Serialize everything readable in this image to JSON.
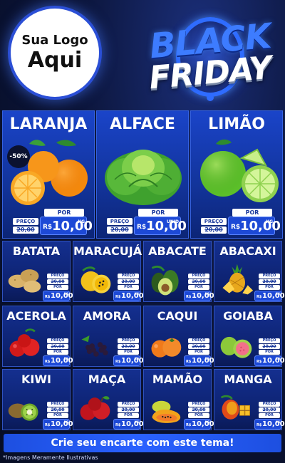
{
  "logo": {
    "line1": "Sua Logo",
    "line2": "Aqui"
  },
  "banner": {
    "black": "BLACK",
    "friday": "FRIDAY"
  },
  "featured": [
    {
      "name": "LARANJA",
      "discount": "-50%",
      "preco_label": "PREÇO",
      "old": "20,00",
      "por": "POR",
      "currency": "R$",
      "price": "10,00",
      "unit": "KG"
    },
    {
      "name": "ALFACE",
      "preco_label": "PREÇO",
      "old": "20,00",
      "por": "POR",
      "currency": "R$",
      "price": "10,00",
      "unit": "UNID"
    },
    {
      "name": "LIMÃO",
      "preco_label": "PREÇO",
      "old": "20,00",
      "por": "POR",
      "currency": "R$",
      "price": "10,00",
      "unit": "KG"
    }
  ],
  "products": [
    {
      "name": "BATATA",
      "preco_label": "PREÇO",
      "old": "20,00",
      "por": "POR",
      "currency": "R$",
      "price": "10,00",
      "unit": "KG"
    },
    {
      "name": "MARACUJÁ",
      "preco_label": "PREÇO",
      "old": "20,00",
      "por": "POR",
      "currency": "R$",
      "price": "10,00",
      "unit": "KG"
    },
    {
      "name": "ABACATE",
      "preco_label": "PREÇO",
      "old": "20,00",
      "por": "POR",
      "currency": "R$",
      "price": "10,00",
      "unit": "KG"
    },
    {
      "name": "ABACAXI",
      "preco_label": "PREÇO",
      "old": "20,00",
      "por": "POR",
      "currency": "R$",
      "price": "10,00",
      "unit": "KG"
    },
    {
      "name": "ACEROLA",
      "preco_label": "PREÇO",
      "old": "20,00",
      "por": "POR",
      "currency": "R$",
      "price": "10,00",
      "unit": "KG"
    },
    {
      "name": "AMORA",
      "preco_label": "PREÇO",
      "old": "20,00",
      "por": "POR",
      "currency": "R$",
      "price": "10,00",
      "unit": "KG"
    },
    {
      "name": "CAQUI",
      "preco_label": "PREÇO",
      "old": "20,00",
      "por": "POR",
      "currency": "R$",
      "price": "10,00",
      "unit": "KG"
    },
    {
      "name": "GOIABA",
      "preco_label": "PREÇO",
      "old": "20,00",
      "por": "POR",
      "currency": "R$",
      "price": "10,00",
      "unit": "KG"
    },
    {
      "name": "KIWI",
      "preco_label": "PREÇO",
      "old": "20,00",
      "por": "POR",
      "currency": "R$",
      "price": "10,00",
      "unit": "KG"
    },
    {
      "name": "MAÇA",
      "preco_label": "PREÇO",
      "old": "20,00",
      "por": "POR",
      "currency": "R$",
      "price": "10,00",
      "unit": "KG"
    },
    {
      "name": "MAMÃO",
      "preco_label": "PREÇO",
      "old": "20,00",
      "por": "POR",
      "currency": "R$",
      "price": "10,00",
      "unit": "KG"
    },
    {
      "name": "MANGA",
      "preco_label": "PREÇO",
      "old": "20,00",
      "por": "POR",
      "currency": "R$",
      "price": "10,00",
      "unit": "KG"
    }
  ],
  "cta": "Crie seu encarte com este tema!",
  "disclaimer": "*Imagens Meramente Ilustrativas",
  "colors": {
    "accent": "#1d49d6",
    "background": "#0a1230",
    "banner_blue": "#3d7cff"
  }
}
